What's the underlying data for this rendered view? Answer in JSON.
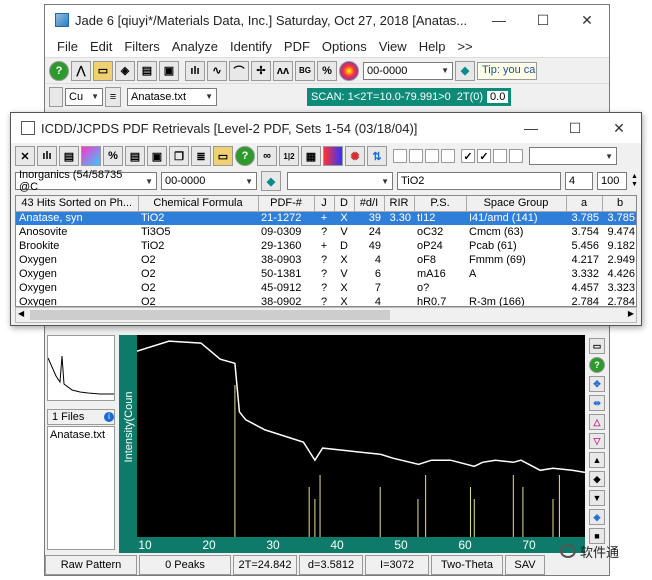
{
  "main": {
    "title": "Jade 6 [qiuyi*/Materials Data, Inc.] Saturday, Oct 27, 2018 [Anatas...",
    "win_min": "—",
    "win_max": "☐",
    "win_close": "✕",
    "menu": [
      "File",
      "Edit",
      "Filters",
      "Analyze",
      "Identify",
      "PDF",
      "Options",
      "View",
      "Help",
      ">>"
    ],
    "pdf_combo": "00-0000",
    "tip": "Tip: you ca",
    "target": "Cu",
    "file_combo": "Anatase.txt",
    "scan": "SCAN: 1<2T=10.0-79.991>0",
    "scan_2t_label": "2T(0)",
    "scan_2t_value": "0.0"
  },
  "left": {
    "files_label": "1 Files",
    "file_item": "Anatase.txt"
  },
  "chart_data": {
    "type": "line",
    "xlabel": "",
    "ylabel": "Intensity(Coun",
    "xlim": [
      10,
      80
    ],
    "x_ticks": [
      "10",
      "20",
      "30",
      "40",
      "50",
      "60",
      "70"
    ],
    "series": [
      {
        "name": "Anatase.txt",
        "x": [
          10,
          15,
          20,
          23,
          25.3,
          26,
          27,
          30,
          33,
          36,
          37.8,
          39,
          42,
          45,
          48,
          50,
          54,
          56,
          59,
          62.7,
          64,
          66,
          68.8,
          70,
          73,
          75,
          78,
          80
        ],
        "y": [
          0.92,
          0.97,
          0.96,
          0.88,
          0.86,
          0.62,
          0.58,
          0.53,
          0.5,
          0.47,
          0.38,
          0.44,
          0.43,
          0.42,
          0.41,
          0.39,
          0.36,
          0.38,
          0.38,
          0.35,
          0.37,
          0.38,
          0.37,
          0.38,
          0.33,
          0.34,
          0.33,
          0.32
        ]
      }
    ],
    "stick_positions": [
      25.3,
      36.9,
      37.8,
      38.6,
      48.0,
      53.9,
      55.1,
      62.1,
      62.7,
      68.8,
      70.3,
      75.0,
      76.0
    ]
  },
  "status": {
    "pattern": "Raw Pattern",
    "peaks": "0 Peaks",
    "two_theta": "2T=24.842",
    "d": "d=3.5812",
    "intensity": "I=3072",
    "axis": "Two-Theta",
    "sav": "SAV"
  },
  "pdf": {
    "title": "ICDD/JCPDS PDF Retrievals [Level-2 PDF, Sets 1-54 (03/18/04)]",
    "win_min": "—",
    "win_max": "☐",
    "win_close": "✕",
    "db_combo": "Inorganics (54/58735 @C",
    "pdf_combo": "00-0000",
    "search_combo": "",
    "formula_input": "TiO2",
    "num1": "4",
    "num2": "100",
    "columns": [
      "43 Hits Sorted on Ph...",
      "Chemical Formula",
      "PDF-#",
      "J",
      "D",
      "#d/I",
      "RIR",
      "P.S.",
      "Space Group",
      "a",
      "b"
    ],
    "rows": [
      [
        "Anatase, syn",
        "TiO2",
        "21-1272",
        "+",
        "X",
        "39",
        "3.30",
        "tI12",
        "I41/amd (141)",
        "3.785",
        "3.785"
      ],
      [
        "Anosovite",
        "Ti3O5",
        "09-0309",
        "?",
        "V",
        "24",
        "",
        "oC32",
        "Cmcm (63)",
        "3.754",
        "9.474"
      ],
      [
        "Brookite",
        "TiO2",
        "29-1360",
        "+",
        "D",
        "49",
        "",
        "oP24",
        "Pcab (61)",
        "5.456",
        "9.182"
      ],
      [
        "Oxygen",
        "O2",
        "38-0903",
        "?",
        "X",
        "4",
        "",
        "oF8",
        "Fmmm (69)",
        "4.217",
        "2.949"
      ],
      [
        "Oxygen",
        "O2",
        "50-1381",
        "?",
        "V",
        "6",
        "",
        "mA16",
        "A",
        "3.332",
        "4.426"
      ],
      [
        "Oxygen",
        "O2",
        "45-0912",
        "?",
        "X",
        "7",
        "",
        "o?",
        "",
        "4.457",
        "3.323"
      ],
      [
        "Oxygen",
        "O2",
        "38-0902",
        "?",
        "X",
        "4",
        "",
        "hR0.7",
        "R-3m (166)",
        "2.784",
        "2.784"
      ]
    ]
  },
  "watermark": "软件通"
}
